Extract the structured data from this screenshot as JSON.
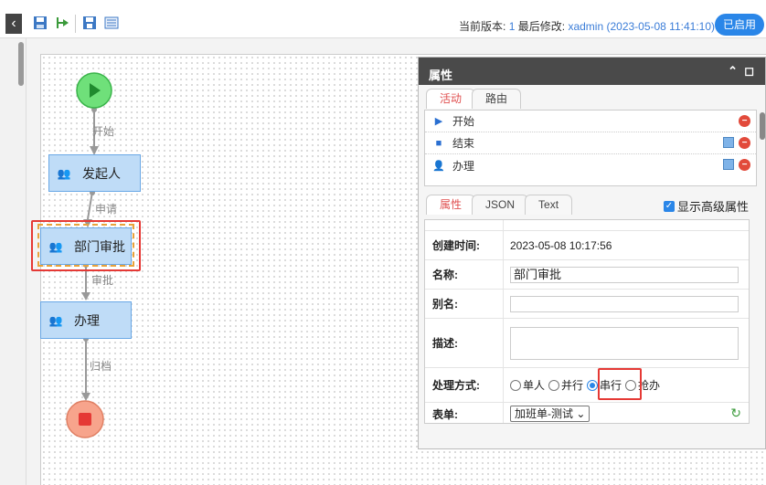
{
  "toolbar": {
    "version_label": "当前版本:",
    "version_value": "1",
    "modified_label": "最后修改:",
    "modified_value": "xadmin (2023-05-08 11:41:10)",
    "enabled_label": "已启用"
  },
  "workflow": {
    "nodes": [
      {
        "label": "发起人"
      },
      {
        "label": "部门审批"
      },
      {
        "label": "办理"
      }
    ],
    "edges": [
      {
        "label": "开始"
      },
      {
        "label": "申请"
      },
      {
        "label": "审批"
      },
      {
        "label": "归档"
      }
    ]
  },
  "panel": {
    "title": "属性",
    "top_tabs": [
      {
        "label": "活动"
      },
      {
        "label": "路由"
      }
    ],
    "activities": [
      {
        "label": "开始",
        "icon": "play-icon"
      },
      {
        "label": "结束",
        "icon": "square-icon"
      },
      {
        "label": "办理",
        "icon": "user-icon"
      }
    ],
    "bottom_tabs": [
      {
        "label": "属性"
      },
      {
        "label": "JSON"
      },
      {
        "label": "Text"
      }
    ],
    "advanced_label": "显示高级属性",
    "advanced_checked": true,
    "props": {
      "created_label": "创建时间:",
      "created_value": "2023-05-08 10:17:56",
      "name_label": "名称:",
      "name_value": "部门审批",
      "alias_label": "别名:",
      "alias_value": "",
      "desc_label": "描述:",
      "desc_value": "",
      "mode_label": "处理方式:",
      "mode_options": [
        {
          "label": "单人",
          "selected": false
        },
        {
          "label": "并行",
          "selected": false
        },
        {
          "label": "串行",
          "selected": true
        },
        {
          "label": "抢办",
          "selected": false
        }
      ],
      "form_label": "表单:",
      "form_value": "加班单-测试"
    }
  }
}
